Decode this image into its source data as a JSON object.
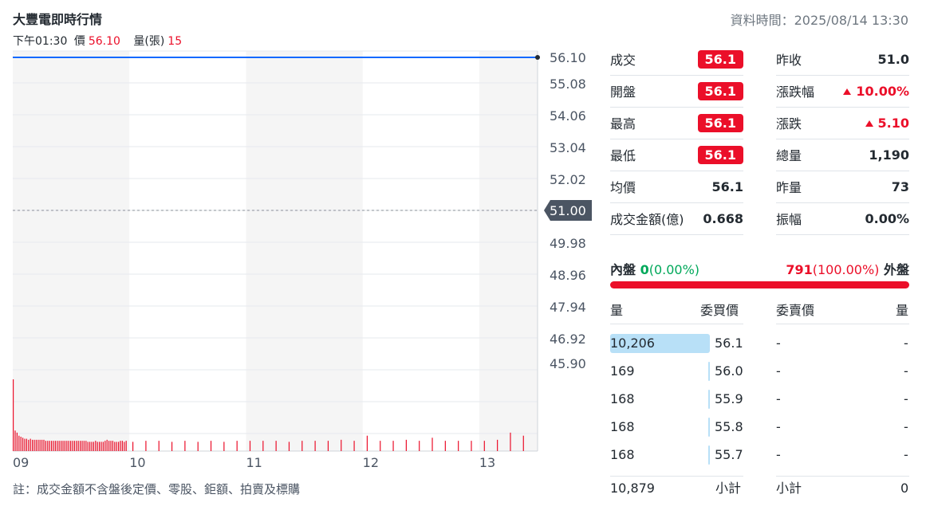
{
  "header": {
    "title": "大豐電即時行情",
    "data_time": "資料時間：2025/08/14 13:30",
    "time_label": "下午01:30",
    "price_label": "價",
    "price_value": "56.10",
    "volume_label": "量(張)",
    "volume_value": "15"
  },
  "chart_data": {
    "type": "line",
    "y_ticks": [
      "56.10",
      "55.08",
      "54.06",
      "53.04",
      "52.02",
      "51.00",
      "49.98",
      "48.96",
      "47.94",
      "46.92",
      "45.90"
    ],
    "x_ticks": [
      "09",
      "10",
      "11",
      "12",
      "13"
    ],
    "prev_close": 51.0,
    "prev_close_label": "51.00",
    "ylim": [
      45.9,
      56.1
    ],
    "series": [
      {
        "values": [
          56.1,
          56.1
        ]
      }
    ],
    "volume": [
      70,
      20,
      18,
      15,
      14,
      13,
      12,
      12,
      11,
      12,
      11,
      11,
      11,
      11,
      11,
      11,
      11,
      10,
      10,
      10,
      10,
      10,
      10,
      10,
      10,
      10,
      10,
      10,
      10,
      10,
      10,
      10,
      10,
      10,
      10,
      10,
      10,
      10,
      10,
      9,
      9,
      9,
      9,
      10,
      9,
      9,
      9,
      9,
      10,
      11,
      10,
      10,
      10,
      9,
      9,
      9,
      10,
      10,
      9,
      10,
      9,
      10,
      10,
      9,
      10,
      9,
      10,
      9,
      10,
      10,
      10,
      10,
      9,
      10,
      10,
      10,
      11,
      10,
      15,
      10,
      10,
      11,
      10,
      13,
      10,
      10,
      10,
      10,
      11,
      18,
      15
    ]
  },
  "note": "註：成交金額不含盤後定價、零股、鉅額、拍賣及標購",
  "stats_left": [
    {
      "label": "成交",
      "value": "56.1",
      "badge": true
    },
    {
      "label": "開盤",
      "value": "56.1",
      "badge": true
    },
    {
      "label": "最高",
      "value": "56.1",
      "badge": true
    },
    {
      "label": "最低",
      "value": "56.1",
      "badge": true
    },
    {
      "label": "均價",
      "value": "56.1",
      "badge": false
    },
    {
      "label": "成交金額(億)",
      "value": "0.668",
      "badge": false
    }
  ],
  "stats_right": [
    {
      "label": "昨收",
      "value": "51.0",
      "up": false
    },
    {
      "label": "漲跌幅",
      "value": "10.00%",
      "up": true
    },
    {
      "label": "漲跌",
      "value": "5.10",
      "up": true
    },
    {
      "label": "總量",
      "value": "1,190",
      "up": false
    },
    {
      "label": "昨量",
      "value": "73",
      "up": false
    },
    {
      "label": "振幅",
      "value": "0.00%",
      "up": false
    }
  ],
  "inout": {
    "inner_label": "內盤",
    "inner_value": "0",
    "inner_pct": "(0.00%)",
    "outer_value": "791",
    "outer_pct": "(100.00%)",
    "outer_label": "外盤",
    "outer_fraction": 1.0
  },
  "orderbook": {
    "headers": [
      "量",
      "委買價",
      "委賣價",
      "量"
    ],
    "rows": [
      {
        "bid_vol": "10,206",
        "bid_price": "56.1",
        "ask_price": "-",
        "ask_vol": "-",
        "fill": 1.0
      },
      {
        "bid_vol": "169",
        "bid_price": "56.0",
        "ask_price": "-",
        "ask_vol": "-",
        "fill": 0.0166
      },
      {
        "bid_vol": "168",
        "bid_price": "55.9",
        "ask_price": "-",
        "ask_vol": "-",
        "fill": 0.0165
      },
      {
        "bid_vol": "168",
        "bid_price": "55.8",
        "ask_price": "-",
        "ask_vol": "-",
        "fill": 0.0165
      },
      {
        "bid_vol": "168",
        "bid_price": "55.7",
        "ask_price": "-",
        "ask_vol": "-",
        "fill": 0.0165
      }
    ],
    "bid_total": "10,879",
    "subtotal_label": "小計",
    "ask_subtotal_label": "小計",
    "ask_total": "0"
  },
  "colors": {
    "up": "#eb0f29",
    "down": "#00a85a",
    "price_line": "#0f69ff",
    "volume_bar": "#eb0f29",
    "session_shade": "#f5f5f5",
    "bid_bar": "#b8e0f7"
  }
}
